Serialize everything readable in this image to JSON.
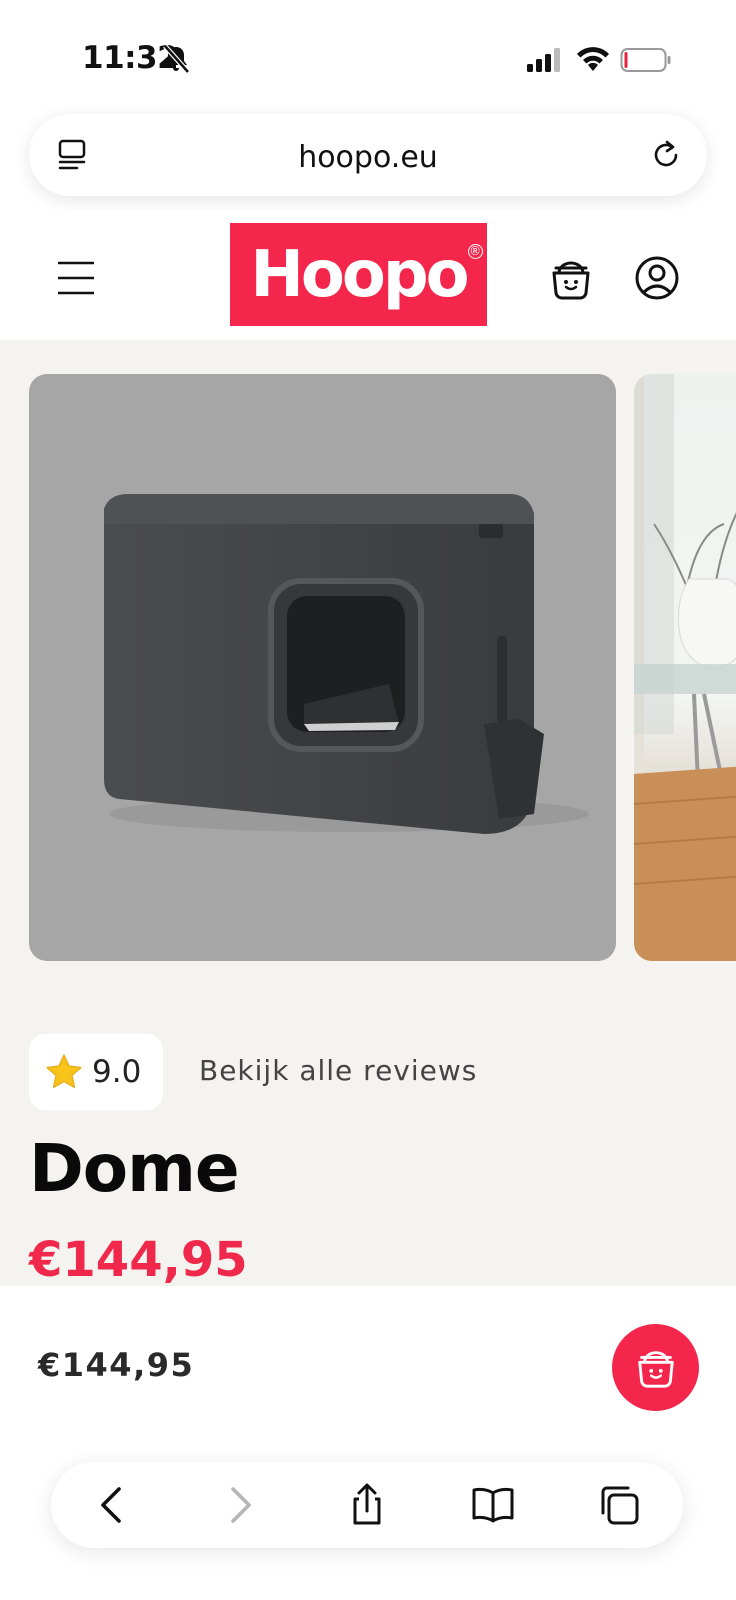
{
  "status_bar": {
    "time": "11:32"
  },
  "address_bar": {
    "url": "hoopo.eu"
  },
  "header": {
    "logo": "Hoopo",
    "logo_mark": "®"
  },
  "product": {
    "rating": "9.0",
    "reviews_link": "Bekijk alle reviews",
    "title": "Dome",
    "price": "€144,95"
  },
  "sticky_bar": {
    "price": "€144,95"
  },
  "colors": {
    "brand": "#f5264b",
    "price": "#f0294c",
    "star": "#f7c41c",
    "page_bg": "#f4f3ef",
    "image_bg": "#a6a6a6"
  },
  "icons": [
    "bell-slash-icon",
    "signal-icon",
    "wifi-icon",
    "battery-icon",
    "reader-icon",
    "reload-icon",
    "menu-icon",
    "basket-icon",
    "account-icon",
    "star-icon",
    "back-icon",
    "forward-icon",
    "share-icon",
    "bookmarks-icon",
    "tabs-icon"
  ]
}
